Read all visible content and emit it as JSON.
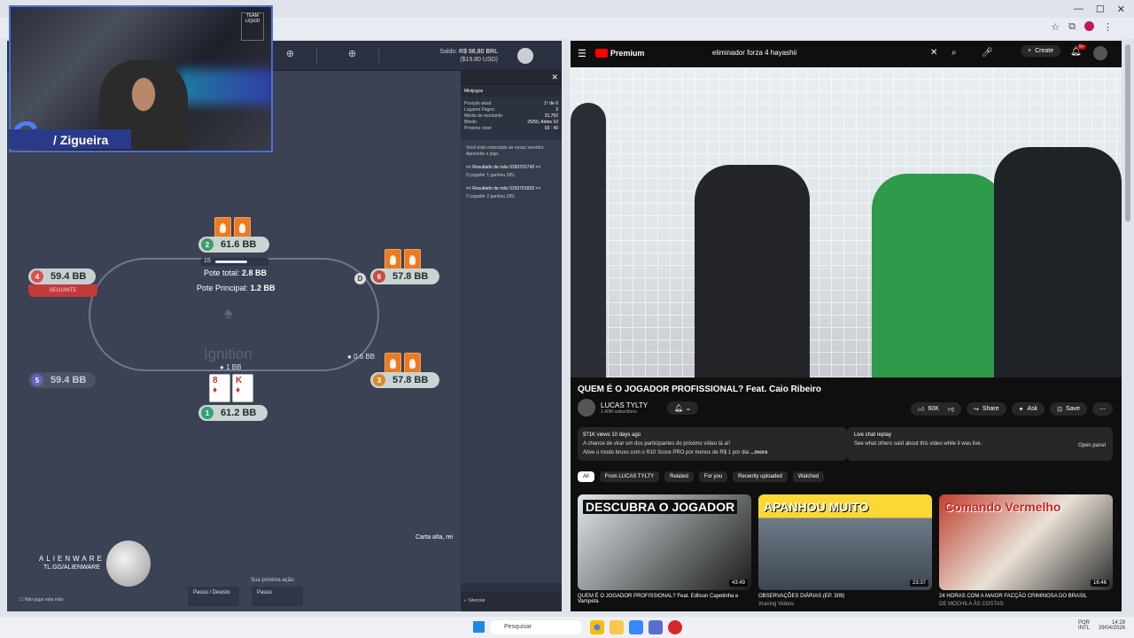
{
  "browser": {
    "tab_strip": ""
  },
  "streamer": {
    "name": "/ Zigueira",
    "team": "TEAM LIQUID"
  },
  "sponsor": {
    "brand": "ALIENWARE",
    "link": "TL.GG/ALIENWARE"
  },
  "poker": {
    "saldo_label": "Saldo:",
    "saldo_value": "R$ 98,80 BRL",
    "saldo_sub": "($19.80 USD)",
    "seats": [
      {
        "num": "4",
        "stack": "59.4 BB",
        "sub": "SEGUINTE",
        "color": "#d6534a"
      },
      {
        "num": "2",
        "stack": "61.6 BB",
        "color": "#3f9b6a"
      },
      {
        "num": "6",
        "stack": "57.8 BB",
        "color": "#cc4a3c"
      },
      {
        "num": "5",
        "stack": "59.4 BB",
        "color": "#6a5fb8"
      },
      {
        "num": "3",
        "stack": "57.8 BB",
        "color": "#d98a26"
      },
      {
        "num": "1",
        "stack": "61.2 BB",
        "color": "#2fa37a"
      }
    ],
    "timer": "15",
    "timer_fraction": 0.65,
    "pot_total_label": "Pote total:",
    "pot_total_value": "2.8 BB",
    "pot_main_label": "Pote Principal:",
    "pot_main_value": "1.2 BB",
    "room": "Ignition",
    "dealer": "D",
    "bet_seat3": "0.6 BB",
    "bet_seat1": "1 BB",
    "hole_cards": [
      {
        "rank": "8",
        "suit": "♦"
      },
      {
        "rank": "K",
        "suit": "♦"
      }
    ],
    "hand_strength": "Carta alta, rei",
    "next_action_label": "Sua próxima ação:",
    "btn_check_fold": "Passo / Desisto",
    "btn_check": "Passo",
    "auto_fold": "Não jogar esta mão"
  },
  "sidebar": {
    "title": "Minijogos",
    "rows": [
      {
        "label": "Posição atual:",
        "value": "1º de 6"
      },
      {
        "label": "Lugares Pagos:",
        "value": "3"
      },
      {
        "label": "Média do montante:",
        "value": "21,750"
      },
      {
        "label": "Blinds:",
        "value": "25/50, Antes 10"
      },
      {
        "label": "Próximo nível:",
        "value": "03 : 40"
      }
    ],
    "chat": [
      "Você está conectado ao nosso servidor. Aproveite o jogo.",
      "<< Resultado da mão 5293701743 >>",
      "O jogador 1 ganhou (95).",
      "<< Resultado da mão 5293701832 >>",
      "O jogador 2 ganhou (95)."
    ],
    "footer": "Silenciar"
  },
  "youtube": {
    "brand": "Premium",
    "search": "eliminador forza 4 hayashii",
    "create": "Create",
    "notif_count": "9+",
    "title": "QUEM É O JOGADOR PROFISSIONAL? Feat. Caio Ribeiro",
    "channel": "LUCAS TYLTY",
    "subs": "1.40M subscribers",
    "likes": "60K",
    "share": "Share",
    "ask": "Ask",
    "save": "Save",
    "views": "971K views  10 days ago",
    "desc1": "A chance de virar um dos participantes do próximo vídeo tá aí!",
    "desc2": "Ative o modo bruxo com o R10 Score PRO por menos de R$ 1 por dia",
    "more": "...more",
    "livechat_title": "Live chat replay",
    "livechat_desc": "See what others said about this video while it was live.",
    "open_panel": "Open panel",
    "chips": [
      "All",
      "From LUCAS TYLTY",
      "Related",
      "For you",
      "Recently uploaded",
      "Watched"
    ],
    "thumbs": [
      {
        "text": "DESCUBRA O JOGADOR",
        "dur": "43:49",
        "title": "QUEM É O JOGADOR PROFISSIONAL? Feat. Edilson Capetinha e Vampeta",
        "meta": ""
      },
      {
        "text": "APANHOU MUITO",
        "dur": "23:37",
        "title": "OBSERVAÇÕES DIÁRIAS (EP. 309)",
        "meta": "Xracing Videos"
      },
      {
        "text": "Comando Vermelho",
        "dur": "16:46",
        "title": "24 HORAS COM A MAIOR FACÇÃO CRIMINOSA DO BRASIL",
        "meta": "DE MOCHILA ÀS COSTAS"
      }
    ]
  },
  "taskbar": {
    "search": "Pesquisar",
    "lang": "POR",
    "kbd": "INTL",
    "time": "14:29",
    "date": "29/04/2026"
  }
}
